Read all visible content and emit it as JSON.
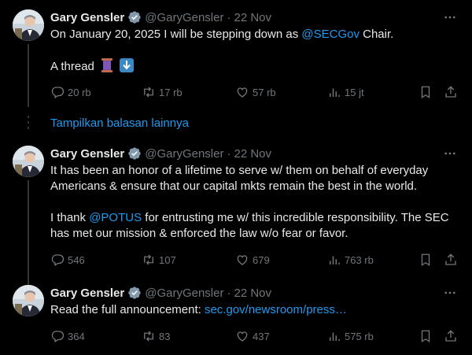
{
  "tweets": [
    {
      "name": "Gary Gensler",
      "handle": "@GaryGensler",
      "date": "22 Nov",
      "text_before": "On January 20, 2025 I will be stepping down as ",
      "mention": "@SECGov",
      "text_after": " Chair.",
      "line2": "A thread",
      "replies": "20 rb",
      "reposts": "17 rb",
      "likes": "57 rb",
      "views": "15 jt"
    },
    {
      "name": "Gary Gensler",
      "handle": "@GaryGensler",
      "date": "22 Nov",
      "para1": "It has been an honor of a lifetime to serve w/ them on behalf of everyday Americans & ensure that our capital mkts remain the best in the world.",
      "para2_before": "I thank ",
      "mention": "@POTUS",
      "para2_after": " for entrusting me w/ this incredible responsibility. The SEC has met our mission & enforced the law w/o fear or favor.",
      "replies": "546",
      "reposts": "107",
      "likes": "679",
      "views": "763 rb"
    },
    {
      "name": "Gary Gensler",
      "handle": "@GaryGensler",
      "date": "22 Nov",
      "text_before": "Read the full announcement: ",
      "link": "sec.gov/newsroom/press…",
      "replies": "364",
      "reposts": "83",
      "likes": "437",
      "views": "575 rb"
    }
  ],
  "show_more": "Tampilkan balasan lainnya",
  "dot": "·",
  "colors": {
    "accent": "#1d9bf0",
    "muted": "#71767b",
    "text": "#e7e9ea",
    "background": "#000000"
  }
}
